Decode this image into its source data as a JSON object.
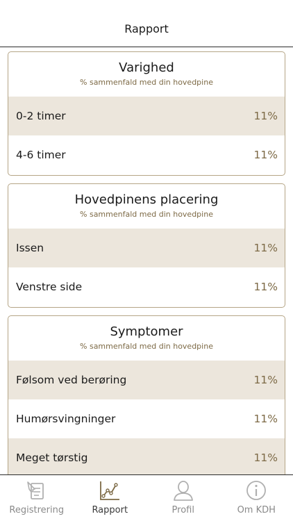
{
  "header": {
    "title": "Rapport"
  },
  "cards": [
    {
      "title": "Varighed",
      "subtitle": "% sammenfald med din hovedpine",
      "rows": [
        {
          "label": "0-2 timer",
          "value": "11%"
        },
        {
          "label": "4-6 timer",
          "value": "11%"
        }
      ]
    },
    {
      "title": "Hovedpinens placering",
      "subtitle": "% sammenfald med din hovedpine",
      "rows": [
        {
          "label": "Issen",
          "value": "11%"
        },
        {
          "label": "Venstre side",
          "value": "11%"
        }
      ]
    },
    {
      "title": "Symptomer",
      "subtitle": "% sammenfald med din hovedpine",
      "rows": [
        {
          "label": "Følsom ved berøring",
          "value": "11%"
        },
        {
          "label": "Humørsvingninger",
          "value": "11%"
        },
        {
          "label": "Meget tørstig",
          "value": "11%"
        }
      ]
    }
  ],
  "tabbar": {
    "items": [
      {
        "label": "Registrering",
        "icon": "registration-icon",
        "active": false
      },
      {
        "label": "Rapport",
        "icon": "chart-icon",
        "active": true
      },
      {
        "label": "Profil",
        "icon": "profile-icon",
        "active": false
      },
      {
        "label": "Om KDH",
        "icon": "info-icon",
        "active": false
      }
    ]
  },
  "colors": {
    "accent": "#7d6a46",
    "card_border": "#b5a586",
    "row_shade": "#ece6dc",
    "icon_inactive": "#b0b0b0",
    "icon_active": "#7d6a46"
  }
}
